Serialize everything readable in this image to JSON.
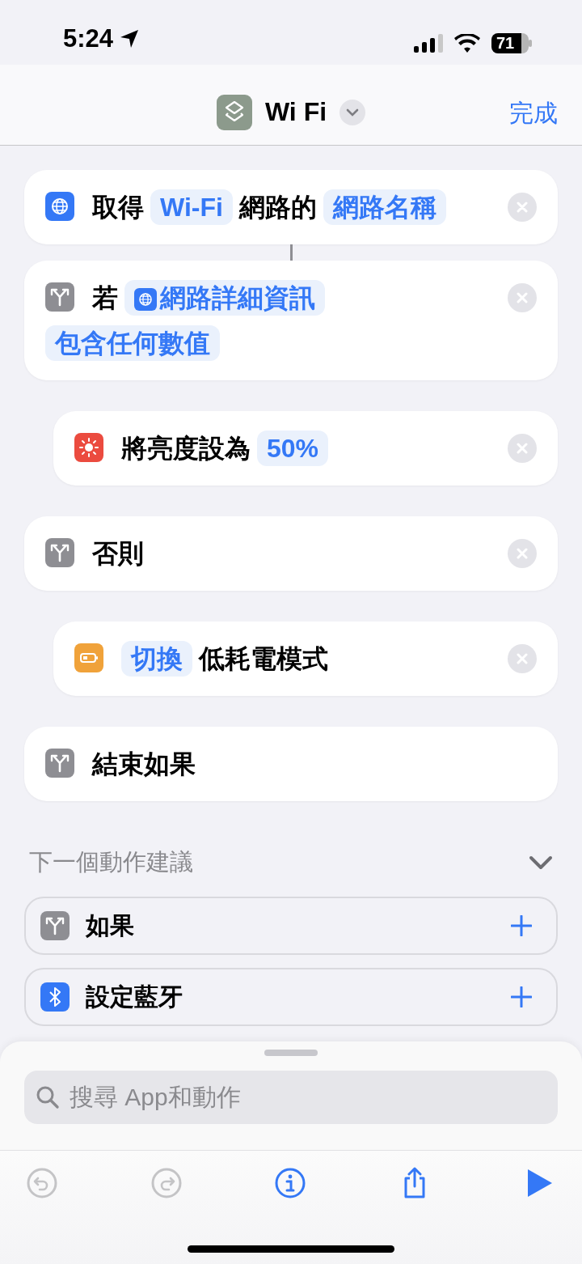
{
  "status_bar": {
    "time": "5:24",
    "battery": "71"
  },
  "nav_bar": {
    "title": "Wi Fi",
    "done": "完成"
  },
  "actions": [
    {
      "kind": "globe",
      "indented": false,
      "removable": true,
      "connector": true,
      "parts": [
        {
          "kind": "text",
          "text": "取得"
        },
        {
          "kind": "token",
          "text": "Wi-Fi"
        },
        {
          "kind": "text",
          "text": "網路的"
        },
        {
          "kind": "token",
          "text": "網路名稱"
        }
      ]
    },
    {
      "kind": "branch",
      "indented": false,
      "removable": true,
      "connector": false,
      "parts": [
        {
          "kind": "text",
          "text": "若"
        },
        {
          "kind": "globe-token",
          "text": "網路詳細資訊"
        },
        {
          "kind": "token",
          "text": "包含任何數值"
        }
      ]
    },
    {
      "kind": "sun",
      "indented": true,
      "removable": true,
      "connector": false,
      "parts": [
        {
          "kind": "text",
          "text": "將亮度設為"
        },
        {
          "kind": "token",
          "text": "50%"
        }
      ]
    },
    {
      "kind": "branch",
      "indented": false,
      "removable": true,
      "connector": false,
      "parts": [
        {
          "kind": "text",
          "text": "否則"
        }
      ]
    },
    {
      "kind": "battery",
      "indented": true,
      "removable": true,
      "connector": false,
      "parts": [
        {
          "kind": "token",
          "text": "切換"
        },
        {
          "kind": "text",
          "text": "低耗電模式"
        }
      ]
    },
    {
      "kind": "branch",
      "indented": false,
      "removable": false,
      "connector": false,
      "parts": [
        {
          "kind": "text",
          "text": "結束如果"
        }
      ]
    }
  ],
  "suggestions": {
    "title": "下一個動作建議",
    "items": [
      {
        "kind": "branch",
        "label": "如果"
      },
      {
        "kind": "bluetooth",
        "label": "設定藍牙"
      }
    ]
  },
  "search": {
    "placeholder": "搜尋 App和動作"
  },
  "toolbar": [
    {
      "kind": "undo",
      "disabled": true
    },
    {
      "kind": "redo",
      "disabled": true
    },
    {
      "kind": "info",
      "disabled": false
    },
    {
      "kind": "share",
      "disabled": false
    },
    {
      "kind": "play",
      "disabled": false
    }
  ]
}
